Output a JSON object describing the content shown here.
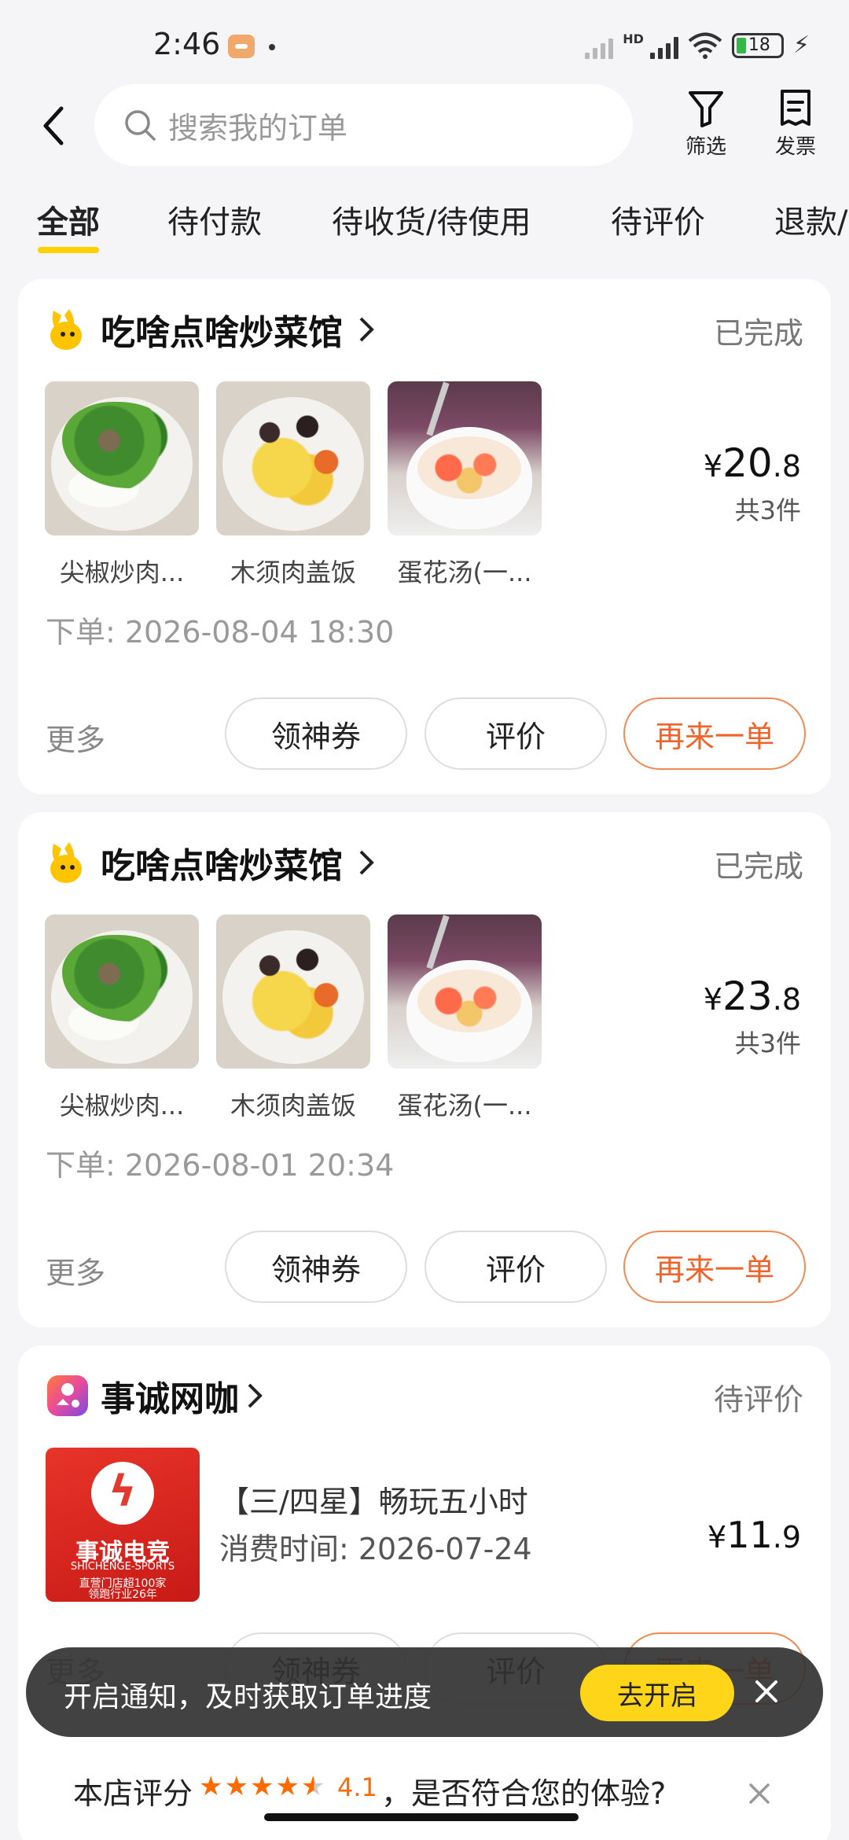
{
  "status_bar": {
    "time": "2:46",
    "battery": "18",
    "network": "HD"
  },
  "search": {
    "placeholder": "搜索我的订单"
  },
  "header_actions": {
    "filter_label": "筛选",
    "invoice_label": "发票"
  },
  "tabs": [
    {
      "label": "全部",
      "active": true
    },
    {
      "label": "待付款"
    },
    {
      "label": "待收货/待使用"
    },
    {
      "label": "待评价"
    },
    {
      "label": "退款/售后"
    }
  ],
  "orders": [
    {
      "shop": "吃啥点啥炒菜馆",
      "status": "已完成",
      "items": [
        {
          "name": "尖椒炒肉..."
        },
        {
          "name": "木须肉盖饭"
        },
        {
          "name": "蛋花汤(一..."
        }
      ],
      "price_symbol": "¥",
      "price_int": "20",
      "price_dec": ".8",
      "quantity": "共3件",
      "order_time": "下单: 2026-08-04 18:30",
      "more": "更多",
      "buttons": {
        "coupon": "领神券",
        "review": "评价",
        "reorder": "再来一单"
      }
    },
    {
      "shop": "吃啥点啥炒菜馆",
      "status": "已完成",
      "items": [
        {
          "name": "尖椒炒肉..."
        },
        {
          "name": "木须肉盖饭"
        },
        {
          "name": "蛋花汤(一..."
        }
      ],
      "price_symbol": "¥",
      "price_int": "23",
      "price_dec": ".8",
      "quantity": "共3件",
      "order_time": "下单: 2026-08-01 20:34",
      "more": "更多",
      "buttons": {
        "coupon": "领神券",
        "review": "评价",
        "reorder": "再来一单"
      }
    },
    {
      "shop": "事诚网咖",
      "status": "待评价",
      "item_title": "【三/四星】畅玩五小时",
      "item_time": "消费时间: 2026-07-24",
      "logo_text": "事诚电竞",
      "logo_sub": "SHICHENGE-SPORTS",
      "logo_line1": "直营门店超100家",
      "logo_line2": "领跑行业26年",
      "price_symbol": "¥",
      "price_int": "11",
      "price_dec": ".9",
      "more": "更多",
      "buttons": {
        "coupon": "领神券",
        "review": "评价",
        "reorder": "再来一单"
      }
    }
  ],
  "toast": {
    "message": "开启通知，及时获取订单进度",
    "action": "去开启"
  },
  "rating_prompt": {
    "prefix": "本店评分",
    "score": "4.1",
    "rating": 4.1,
    "suffix": "，是否符合您的体验?"
  },
  "colors": {
    "accent": "#ffd100",
    "reorder": "#f0632a",
    "star": "#ff6a00"
  }
}
